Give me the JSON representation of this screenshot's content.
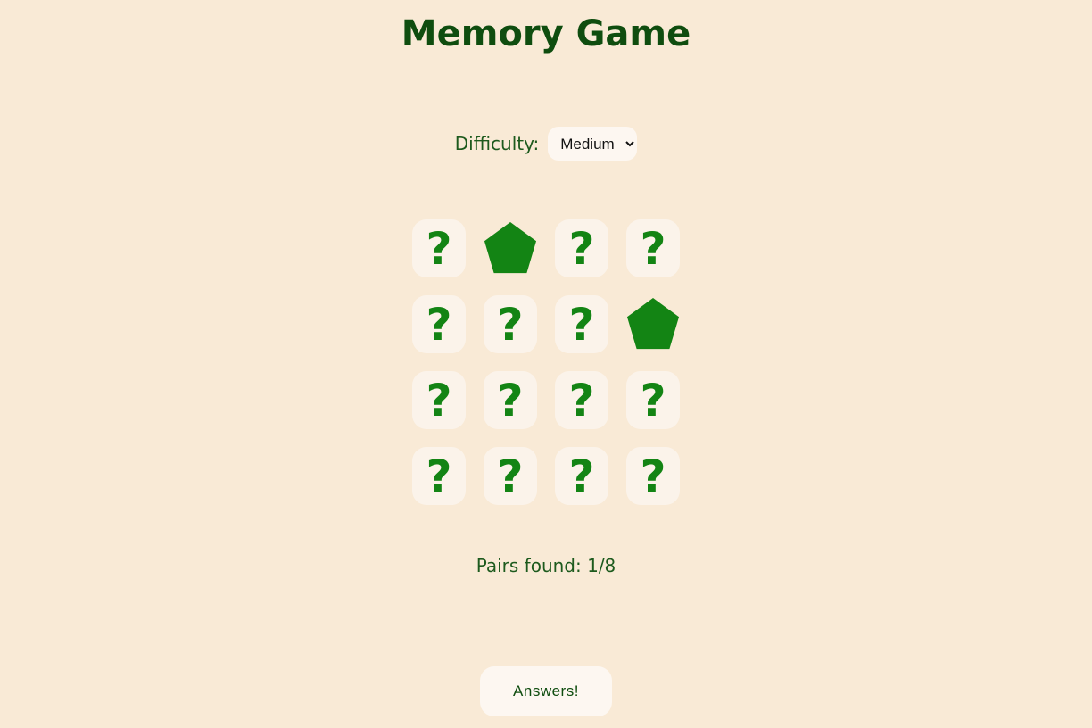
{
  "app": {
    "title": "Memory Game"
  },
  "difficulty": {
    "label": "Difficulty:",
    "selected": "Medium"
  },
  "board": {
    "columns": 4,
    "rows": 4,
    "hidden_symbol": "?",
    "cards": [
      {
        "state": "hidden"
      },
      {
        "state": "revealed",
        "shape": "pentagon-icon"
      },
      {
        "state": "hidden"
      },
      {
        "state": "hidden"
      },
      {
        "state": "hidden"
      },
      {
        "state": "hidden"
      },
      {
        "state": "hidden"
      },
      {
        "state": "revealed",
        "shape": "pentagon-icon"
      },
      {
        "state": "hidden"
      },
      {
        "state": "hidden"
      },
      {
        "state": "hidden"
      },
      {
        "state": "hidden"
      },
      {
        "state": "hidden"
      },
      {
        "state": "hidden"
      },
      {
        "state": "hidden"
      },
      {
        "state": "hidden"
      }
    ]
  },
  "status": {
    "pairs_text": "Pairs found: 1/8"
  },
  "actions": {
    "answers_label": "Answers!"
  },
  "colors": {
    "background": "#f9ead6",
    "card_face": "#fbf3ea",
    "symbol_green": "#138414",
    "text_green": "#0f4d0f"
  }
}
